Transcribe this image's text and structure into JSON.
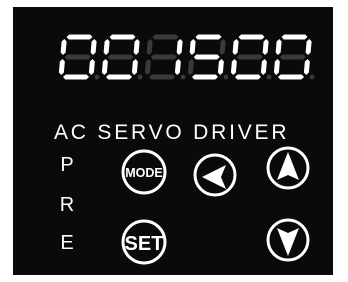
{
  "display": {
    "digits": [
      "0",
      "0",
      "1",
      "5",
      "0",
      "0"
    ]
  },
  "title": "AC SERVO DRIVER",
  "side_labels": [
    "P",
    "R",
    "E"
  ],
  "buttons": {
    "mode": "MODE",
    "set": "SET"
  }
}
